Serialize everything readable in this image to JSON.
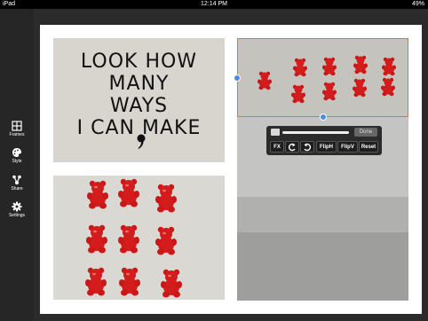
{
  "status_bar": {
    "device": "iPad",
    "time": "12:14 PM",
    "battery": "49%"
  },
  "sidebar": {
    "items": [
      {
        "label": "Frames",
        "icon": "frames-grid-icon"
      },
      {
        "label": "Style",
        "icon": "palette-icon"
      },
      {
        "label": "Share",
        "icon": "share-icon"
      },
      {
        "label": "Settings",
        "icon": "gear-icon"
      }
    ]
  },
  "collage": {
    "text_lines": [
      "LOOK HOW MANY",
      "WAYS",
      "I CAN MAKE"
    ]
  },
  "edit_toolbar": {
    "done_label": "Done",
    "buttons": [
      "FX",
      "",
      "",
      "FlipH",
      "FlipV",
      "Reset"
    ],
    "rotate_left_icon": "rotate-left-icon",
    "rotate_right_icon": "rotate-right-icon"
  },
  "colors": {
    "selection": "#4a8fd9",
    "bear_red": "#d41c1c",
    "sidebar": "#262626"
  }
}
